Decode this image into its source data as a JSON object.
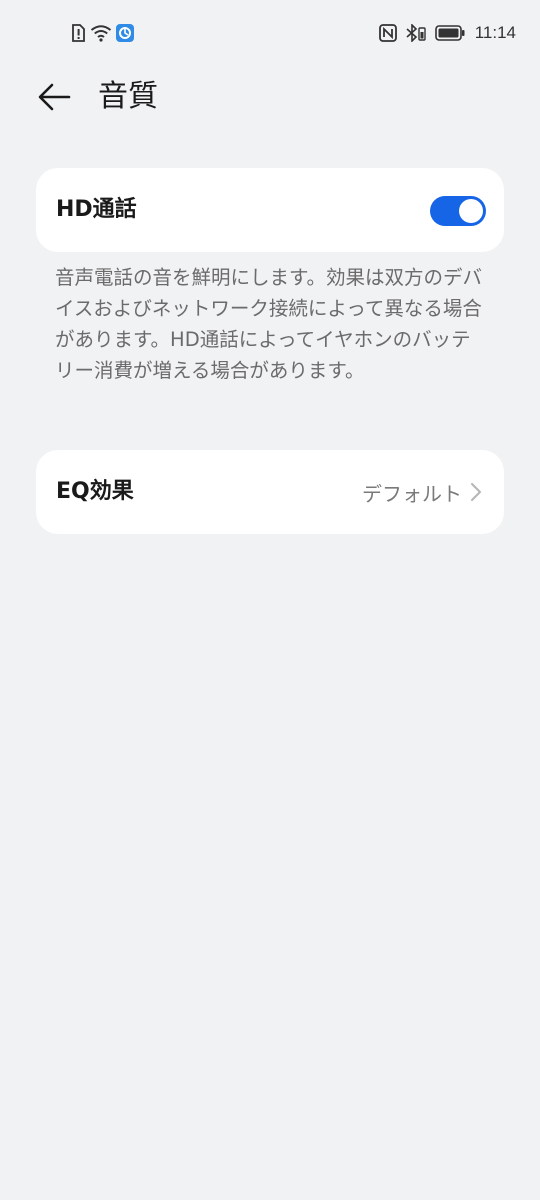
{
  "status_bar": {
    "time": "11:14",
    "left_icons": [
      "alert-sim-icon",
      "wifi-icon",
      "app-notification-icon"
    ],
    "right_icons": [
      "nfc-icon",
      "bluetooth-icon",
      "battery-icon"
    ]
  },
  "header": {
    "title": "音質",
    "back_icon": "arrow-left-icon"
  },
  "hd_call": {
    "label": "HD通話",
    "enabled": true,
    "accent_color": "#1565e6",
    "description": "音声電話の音を鮮明にします。効果は双方のデバイスおよびネットワーク接続によって異なる場合があります。HD通話によってイヤホンのバッテリー消費が増える場合があります。"
  },
  "eq": {
    "label": "EQ効果",
    "value": "デフォルト",
    "chevron_icon": "chevron-right-icon"
  }
}
